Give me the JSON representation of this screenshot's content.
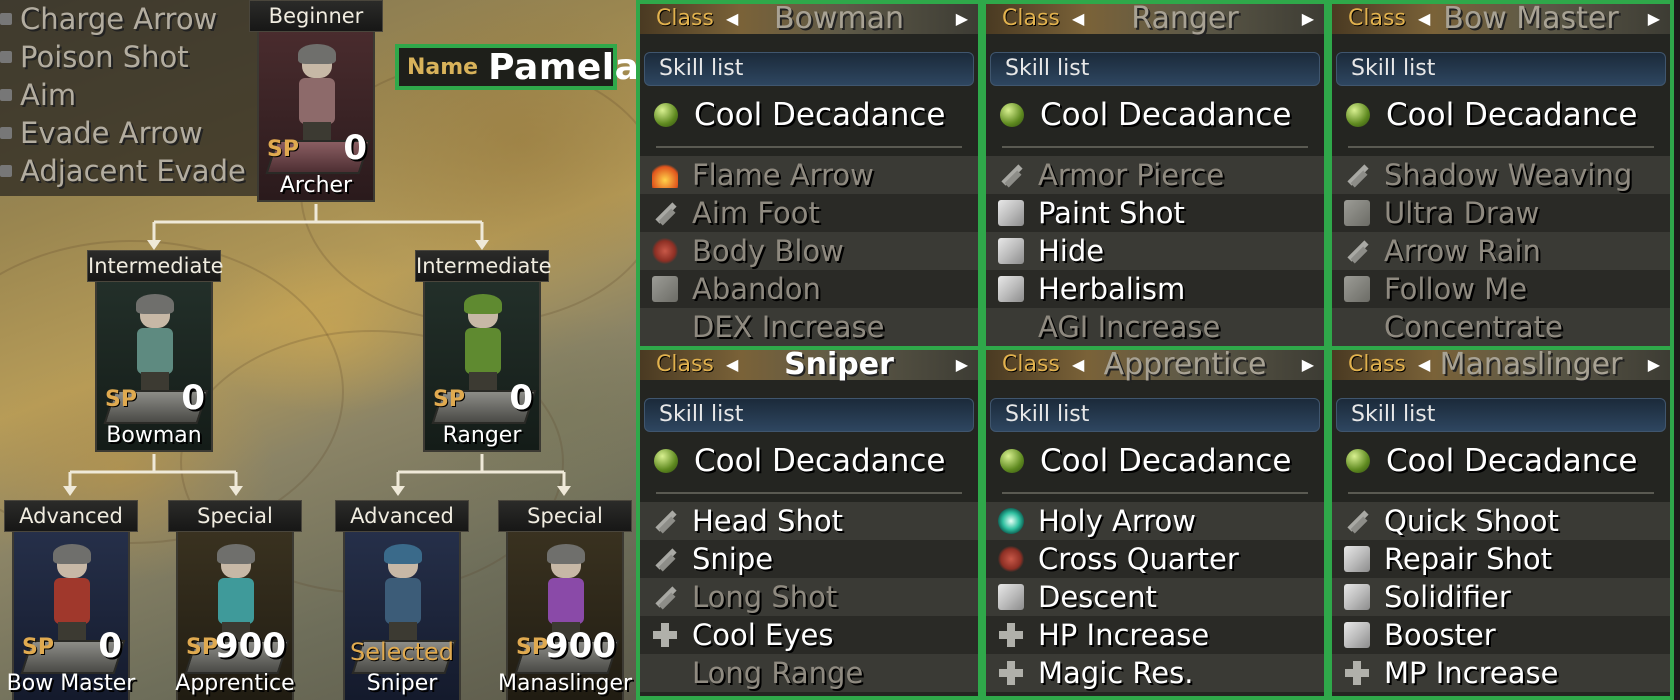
{
  "learned_skills": [
    "Charge Arrow",
    "Poison Shot",
    "Aim",
    "Evade Arrow",
    "Adjacent Evade"
  ],
  "character": {
    "name_label": "Name",
    "name": "Pamela"
  },
  "tree": [
    {
      "id": "archer",
      "tier": "Beginner",
      "class": "Archer",
      "sp_label": "SP",
      "sp": "0",
      "selected_text": ""
    },
    {
      "id": "bowman",
      "tier": "Intermediate",
      "class": "Bowman",
      "sp_label": "SP",
      "sp": "0",
      "selected_text": ""
    },
    {
      "id": "ranger",
      "tier": "Intermediate",
      "class": "Ranger",
      "sp_label": "SP",
      "sp": "0",
      "selected_text": ""
    },
    {
      "id": "bowmaster",
      "tier": "Advanced",
      "class": "Bow Master",
      "sp_label": "SP",
      "sp": "0",
      "selected_text": ""
    },
    {
      "id": "apprentice",
      "tier": "Special",
      "class": "Apprentice",
      "sp_label": "SP",
      "sp": "900",
      "selected_text": ""
    },
    {
      "id": "sniper",
      "tier": "Advanced",
      "class": "Sniper",
      "sp_label": "",
      "sp": "",
      "selected_text": "Selected"
    },
    {
      "id": "manaslinger",
      "tier": "Special",
      "class": "Manaslinger",
      "sp_label": "SP",
      "sp": "900",
      "selected_text": ""
    }
  ],
  "panels": [
    {
      "class_label": "Class",
      "class_name": "Bowman",
      "active": false,
      "skill_list_label": "Skill list",
      "unique_skill": "Cool Decadance",
      "skills": [
        {
          "name": "Flame Arrow",
          "icon": "fire-icon",
          "learned": false
        },
        {
          "name": "Aim Foot",
          "icon": "sword-icon",
          "learned": false
        },
        {
          "name": "Body Blow",
          "icon": "fist-icon",
          "learned": false
        },
        {
          "name": "Abandon",
          "icon": "cube-icon",
          "learned": false
        },
        {
          "name": "DEX Increase",
          "icon": "none",
          "learned": false
        }
      ]
    },
    {
      "class_label": "Class",
      "class_name": "Ranger",
      "active": false,
      "skill_list_label": "Skill list",
      "unique_skill": "Cool Decadance",
      "skills": [
        {
          "name": "Armor Pierce",
          "icon": "sword-icon",
          "learned": false
        },
        {
          "name": "Paint Shot",
          "icon": "cube-icon",
          "learned": true
        },
        {
          "name": "Hide",
          "icon": "cube-icon",
          "learned": true
        },
        {
          "name": "Herbalism",
          "icon": "cube-icon",
          "learned": true
        },
        {
          "name": "AGI Increase",
          "icon": "none",
          "learned": false
        }
      ]
    },
    {
      "class_label": "Class",
      "class_name": "Bow Master",
      "active": false,
      "skill_list_label": "Skill list",
      "unique_skill": "Cool Decadance",
      "skills": [
        {
          "name": "Shadow Weaving",
          "icon": "sword-icon",
          "learned": false
        },
        {
          "name": "Ultra Draw",
          "icon": "cube-icon",
          "learned": false
        },
        {
          "name": "Arrow Rain",
          "icon": "sword-icon",
          "learned": false
        },
        {
          "name": "Follow Me",
          "icon": "cube-icon",
          "learned": false
        },
        {
          "name": "Concentrate",
          "icon": "none",
          "learned": false
        }
      ]
    },
    {
      "class_label": "Class",
      "class_name": "Sniper",
      "active": true,
      "skill_list_label": "Skill list",
      "unique_skill": "Cool Decadance",
      "skills": [
        {
          "name": "Head Shot",
          "icon": "sword-icon",
          "learned": true
        },
        {
          "name": "Snipe",
          "icon": "sword-icon",
          "learned": true
        },
        {
          "name": "Long Shot",
          "icon": "sword-icon",
          "learned": false
        },
        {
          "name": "Cool Eyes",
          "icon": "dpad-icon",
          "learned": true
        },
        {
          "name": "Long Range",
          "icon": "none",
          "learned": false
        }
      ]
    },
    {
      "class_label": "Class",
      "class_name": "Apprentice",
      "active": false,
      "skill_list_label": "Skill list",
      "unique_skill": "Cool Decadance",
      "skills": [
        {
          "name": "Holy Arrow",
          "icon": "ring-icon",
          "learned": true
        },
        {
          "name": "Cross Quarter",
          "icon": "fist-icon",
          "learned": true
        },
        {
          "name": "Descent",
          "icon": "cube-icon",
          "learned": true
        },
        {
          "name": "HP Increase",
          "icon": "dpad-icon",
          "learned": true
        },
        {
          "name": "Magic Res.",
          "icon": "dpad-icon",
          "learned": true
        }
      ]
    },
    {
      "class_label": "Class",
      "class_name": "Manaslinger",
      "active": false,
      "skill_list_label": "Skill list",
      "unique_skill": "Cool Decadance",
      "skills": [
        {
          "name": "Quick Shoot",
          "icon": "sword-icon",
          "learned": true
        },
        {
          "name": "Repair Shot",
          "icon": "cube-icon",
          "learned": true
        },
        {
          "name": "Solidifier",
          "icon": "cube-icon",
          "learned": true
        },
        {
          "name": "Booster",
          "icon": "cube-icon",
          "learned": true
        },
        {
          "name": "MP Increase",
          "icon": "dpad-icon",
          "learned": true
        }
      ]
    }
  ],
  "colors": {
    "highlight_border": "#2fa84a",
    "sp_label": "#e0aa50",
    "class_label": "#e2b24e"
  }
}
